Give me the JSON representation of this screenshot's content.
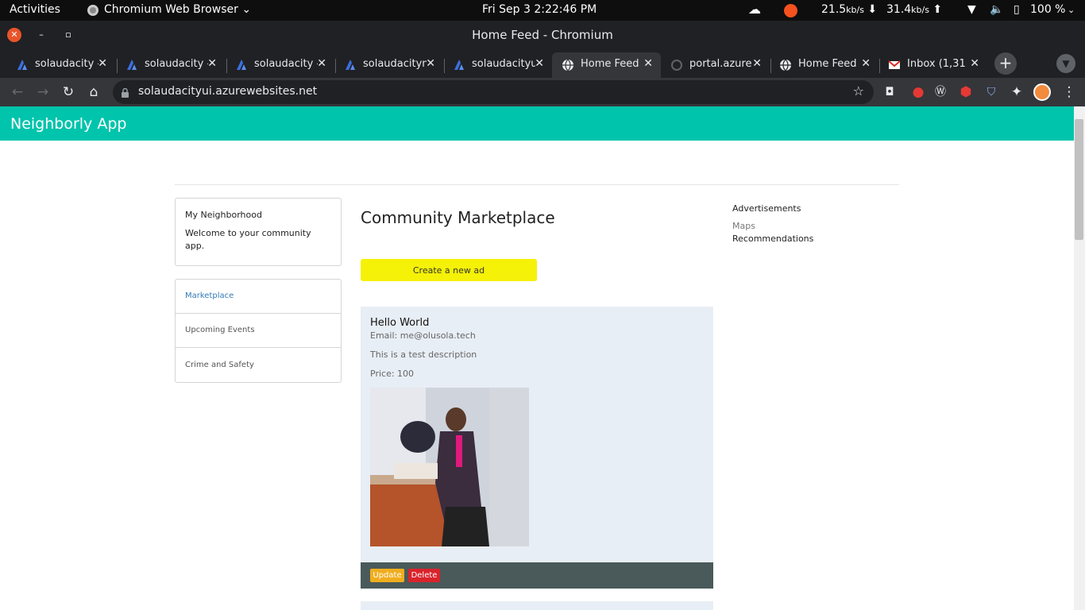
{
  "system_bar": {
    "activities": "Activities",
    "app_name": "Chromium Web Browser",
    "clock": "Fri Sep 3   2:22:46 PM",
    "net_down": "21.5",
    "net_down_unit": "kb/s",
    "net_up": "31.4",
    "net_up_unit": "kb/s",
    "battery": "100 %"
  },
  "window": {
    "title": "Home Feed - Chromium"
  },
  "tabs": [
    {
      "label": "solaudacity -",
      "icon": "azure-icon",
      "active": false
    },
    {
      "label": "solaudacity -",
      "icon": "azure-icon",
      "active": false
    },
    {
      "label": "solaudacity -",
      "icon": "azure-icon",
      "active": false
    },
    {
      "label": "solaudacityn",
      "icon": "azure-icon",
      "active": false
    },
    {
      "label": "solaudacityu",
      "icon": "azure-icon",
      "active": false
    },
    {
      "label": "Home Feed",
      "icon": "globe-icon",
      "active": true
    },
    {
      "label": "portal.azure",
      "icon": "loading-icon",
      "active": false
    },
    {
      "label": "Home Feed",
      "icon": "globe-icon",
      "active": false
    },
    {
      "label": "Inbox (1,31",
      "icon": "gmail-icon",
      "active": false
    }
  ],
  "toolbar": {
    "url": "solaudacityui.azurewebsites.net"
  },
  "app": {
    "brand": "Neighborly App",
    "sidebar": {
      "heading": "My Neighborhood",
      "welcome": "Welcome to your community app.",
      "nav": [
        {
          "label": "Marketplace",
          "active": true
        },
        {
          "label": "Upcoming Events",
          "active": false
        },
        {
          "label": "Crime and Safety",
          "active": false
        }
      ]
    },
    "main": {
      "title": "Community Marketplace",
      "create_button": "Create a new ad",
      "ads": [
        {
          "title": "Hello World",
          "email": "Email: me@olusola.tech",
          "description": "This is a test description",
          "price": "Price: 100",
          "update_label": "Update",
          "delete_label": "Delete"
        }
      ]
    },
    "right": {
      "advertisements": "Advertisements",
      "maps": "Maps",
      "recommendations": "Recommendations"
    }
  },
  "colors": {
    "brand": "#00c4ac",
    "create_button": "#f5f107",
    "update_button": "#f0ad1e",
    "delete_button": "#d9232b",
    "link": "#337ab7"
  }
}
